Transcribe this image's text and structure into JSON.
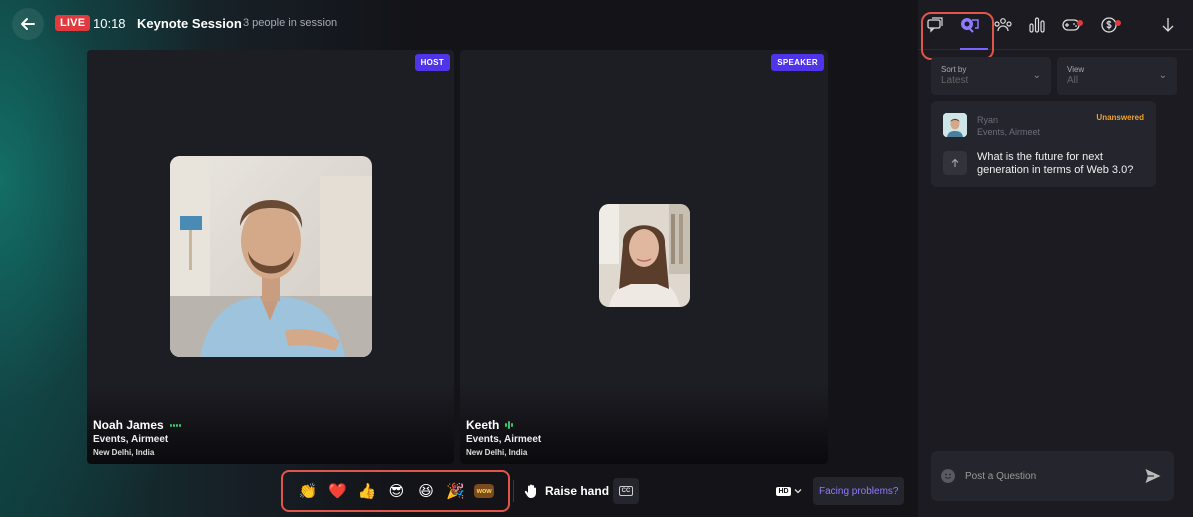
{
  "header": {
    "live_label": "LIVE",
    "timer": "10:18",
    "title": "Keynote Session",
    "people_count": "3 people in session"
  },
  "tiles": {
    "host": {
      "badge": "HOST",
      "name": "Noah James",
      "org": "Events, Airmeet",
      "location": "New Delhi, India"
    },
    "speaker": {
      "badge": "SPEAKER",
      "name": "Keeth",
      "org": "Events, Airmeet",
      "location": "New Delhi, India"
    }
  },
  "reactions": [
    "👏",
    "❤️",
    "👍",
    "😎",
    "😆",
    "🎉",
    "wow"
  ],
  "controls": {
    "raise_hand": "Raise hand",
    "cc": "CC",
    "hd": "HD",
    "facing_problems": "Facing problems?"
  },
  "sidebar": {
    "tabs": [
      "chat-icon",
      "qa-icon",
      "people-icon",
      "polls-icon",
      "games-icon",
      "booth-icon",
      "download-icon"
    ],
    "sort": {
      "label": "Sort by",
      "value": "Latest"
    },
    "view": {
      "label": "View",
      "value": "All"
    },
    "question": {
      "name": "Ryan",
      "org": "Events, Airmeet",
      "status": "Unanswered",
      "text": "What is the future for next generation in terms of Web 3.0?"
    },
    "input_placeholder": "Post a Question"
  },
  "colors": {
    "accent": "#4f35e8",
    "live": "#e0393e",
    "highlight": "#e0564a",
    "status_unanswered": "#f0a22e"
  }
}
